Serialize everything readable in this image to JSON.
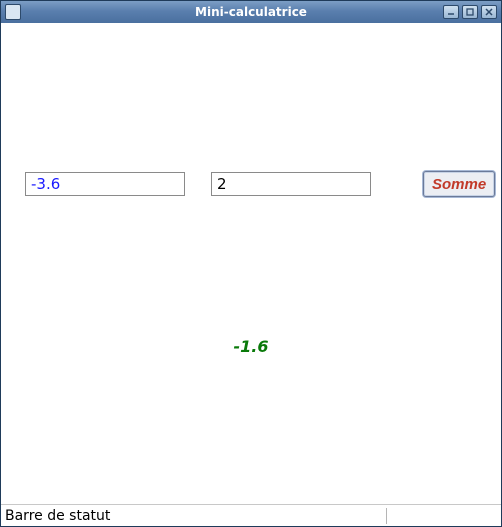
{
  "window": {
    "title": "Mini-calculatrice"
  },
  "inputs": {
    "a": "-3.6",
    "b": "2"
  },
  "buttons": {
    "sum": "Somme"
  },
  "result": "-1.6",
  "statusbar": {
    "text": "Barre de statut"
  }
}
